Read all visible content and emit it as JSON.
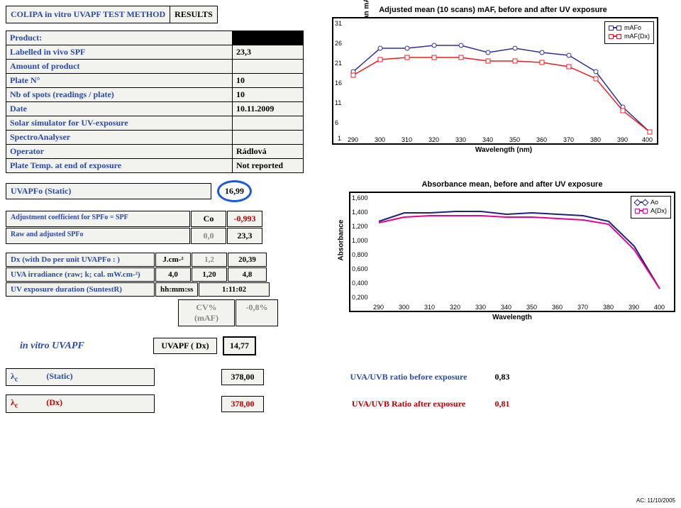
{
  "header": {
    "title_a": "COLIPA in vitro UVAPF TEST METHOD",
    "title_b": "RESULTS",
    "rows": [
      {
        "l": "Product:",
        "v": ""
      },
      {
        "l": "Labelled in vivo SPF",
        "v": "23,3"
      },
      {
        "l": "Amount of product",
        "v": ""
      },
      {
        "l": "Plate N°",
        "v": "10"
      },
      {
        "l": "Nb of spots (readings / plate)",
        "v": "10"
      },
      {
        "l": "Date",
        "v": "10.11.2009"
      },
      {
        "l": "Solar simulator for UV-exposure",
        "v": ""
      },
      {
        "l": "SpectroAnalyser",
        "v": ""
      },
      {
        "l": "Operator",
        "v": "Rádlová"
      },
      {
        "l": "Plate Temp. at end of exposure",
        "v": "Not reported"
      }
    ]
  },
  "chart1": {
    "title": "Adjusted mean (10 scans) mAF, before and after UV exposure",
    "ylabel": "Adjusted normed mean mAF( )",
    "xlabel": "Wavelength (nm)",
    "legend": [
      "mAFo",
      "mAF(Dx)"
    ]
  },
  "mid": {
    "uvapfo_label": "UVAPFo               (Static)",
    "uvapfo_val": "16,99",
    "adj_label": "Adjustment coefficient for SPFo = SPF",
    "adj_c": "Co",
    "adj_v": "-0,993",
    "raw_label": "Raw and adjusted SPFo",
    "raw_a": "0,0",
    "raw_b": "23,3",
    "dx_label": "Dx          (with Do per unit UVAPFo : )",
    "dx_unit": "J.cm-²",
    "dx_a": "1,2",
    "dx_b": "20,39",
    "uva_label": "UVA irradiance (raw; k; cal. mW.cm-²)",
    "uva_a": "4,0",
    "uva_b": "1,20",
    "uva_c": "4,8",
    "uvexp_label": "UV exposure duration (SuntestR)",
    "uvexp_u": "hh:mm:ss",
    "uvexp_v": "1:11:02",
    "cv_l": "CV% (mAF)",
    "cv_v": "-0,8%",
    "final_label": "in vitro UVAPF",
    "final_u": "UVAPF ( Dx)",
    "final_v": "14,77"
  },
  "chart2": {
    "title": "Absorbance mean, before and after UV exposure",
    "ylabel": "Absorbance",
    "xlabel": "Wavelength",
    "legend": [
      "Ao",
      "A(Dx)"
    ]
  },
  "bottom": {
    "lc_static": "λc               (Static)",
    "lc_static_v": "378,00",
    "lc_dx": "λc               (Dx)",
    "lc_dx_v": "378,00",
    "ratio_before": "UVA/UVB ratio before exposure",
    "ratio_before_v": "0,83",
    "ratio_after": "UVA/UVB Ratio after exposure",
    "ratio_after_v": "0,81",
    "ac": "AC:   11/10/2005"
  },
  "chart_data": [
    {
      "type": "line",
      "title": "Adjusted mean (10 scans) mAF, before and after UV exposure",
      "xlabel": "Wavelength (nm)",
      "ylabel": "Adjusted normed mean mAF( )",
      "ylim": [
        1,
        31
      ],
      "x": [
        290,
        300,
        310,
        320,
        330,
        340,
        350,
        360,
        370,
        380,
        390,
        400
      ],
      "series": [
        {
          "name": "mAFo",
          "values": [
            18,
            24,
            24,
            25,
            25,
            23,
            24,
            23,
            22,
            18,
            8,
            2
          ]
        },
        {
          "name": "mAF(Dx)",
          "values": [
            17,
            21,
            22,
            22,
            22,
            21,
            21,
            20,
            19,
            16,
            7,
            2
          ]
        }
      ]
    },
    {
      "type": "line",
      "title": "Absorbance mean, before and after UV exposure",
      "xlabel": "Wavelength",
      "ylabel": "Absorbance",
      "ylim": [
        0.0,
        1.6
      ],
      "x": [
        290,
        300,
        310,
        320,
        330,
        340,
        350,
        360,
        370,
        380,
        390,
        400
      ],
      "series": [
        {
          "name": "Ao",
          "values": [
            1.25,
            1.38,
            1.38,
            1.4,
            1.4,
            1.36,
            1.38,
            1.36,
            1.34,
            1.25,
            0.9,
            0.3
          ]
        },
        {
          "name": "A(Dx)",
          "values": [
            1.23,
            1.32,
            1.34,
            1.34,
            1.34,
            1.32,
            1.32,
            1.3,
            1.28,
            1.2,
            0.85,
            0.3
          ]
        }
      ]
    }
  ]
}
